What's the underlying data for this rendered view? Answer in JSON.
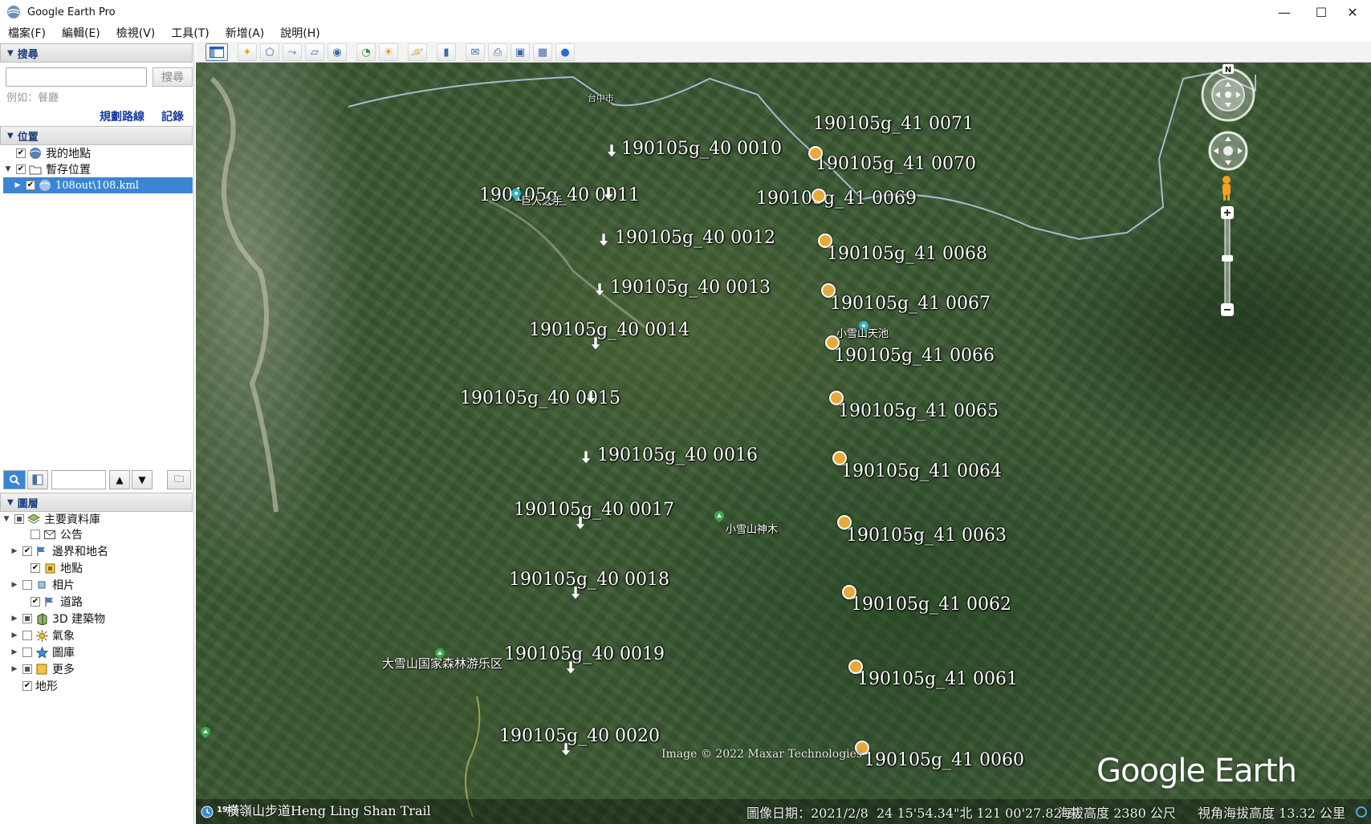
{
  "window": {
    "title": "Google Earth Pro",
    "minimize": "—",
    "maximize": "☐",
    "close": "✕"
  },
  "menu": [
    "檔案(F)",
    "編輯(E)",
    "檢視(V)",
    "工具(T)",
    "新增(A)",
    "說明(H)"
  ],
  "search": {
    "header": "搜尋",
    "input_value": "",
    "button_label": "搜尋",
    "hint": "例如：餐廳",
    "link_directions": "規劃路線",
    "link_history": "記錄"
  },
  "places": {
    "header": "位置",
    "items": [
      {
        "label": "我的地點",
        "checked": true
      },
      {
        "label": "暫存位置",
        "checked": true
      },
      {
        "label": "108out\\108.kml",
        "checked": true,
        "selected": true
      }
    ]
  },
  "layers": {
    "header": "圖層",
    "root": "主要資料庫",
    "items": [
      {
        "label": "公告",
        "checked": false
      },
      {
        "label": "邊界和地名",
        "checked": true
      },
      {
        "label": "地點",
        "checked": true
      },
      {
        "label": "相片",
        "checked": false
      },
      {
        "label": "道路",
        "checked": true
      },
      {
        "label": "3D 建築物",
        "checked": "partial"
      },
      {
        "label": "氣象",
        "checked": false
      },
      {
        "label": "圖庫",
        "checked": false
      },
      {
        "label": "更多",
        "checked": "partial"
      },
      {
        "label": "地形",
        "checked": true
      }
    ]
  },
  "map": {
    "left_markers": [
      "190105g_40 0010",
      "190105g_40 0011",
      "190105g_40 0012",
      "190105g_40 0013",
      "190105g_40 0014",
      "190105g_40 0015",
      "190105g_40 0016",
      "190105g_40 0017",
      "190105g_40 0018",
      "190105g_40 0019",
      "190105g_40 0020"
    ],
    "right_markers": [
      "190105g_41 0071",
      "190105g_41 0070",
      "190105g_41 0069",
      "190105g_41 0068",
      "190105g_41 0067",
      "190105g_41 0066",
      "190105g_41 0065",
      "190105g_41 0064",
      "190105g_41 0063",
      "190105g_41 0062",
      "190105g_41 0061",
      "190105g_41 0060"
    ],
    "pois": {
      "giant_hand": "巨人之手",
      "pond": "小雪山天池",
      "sacred_tree": "小雪山神木",
      "forest_area": "大雪山国家森林游乐区",
      "river_label": "台中市",
      "trail": "橫嶺山步道Heng Ling Shan Trail"
    },
    "attribution": "Image © 2022 Maxar Technologies",
    "logo": "Google Earth",
    "year_badge": "1985",
    "nav_north": "N"
  },
  "status": {
    "image_date": "圖像日期：2021/2/8",
    "coords": "24 15'54.34\"北  121 00'27.82\"東",
    "elevation": "海拔高度  2380 公尺",
    "eye_alt": "視角海拔高度  13.32 公里"
  },
  "colors": {
    "selection": "#3b86d4",
    "marker_orange": "#e8a83a",
    "header_text": "#1a3d7c",
    "link": "#1a3d9c"
  }
}
